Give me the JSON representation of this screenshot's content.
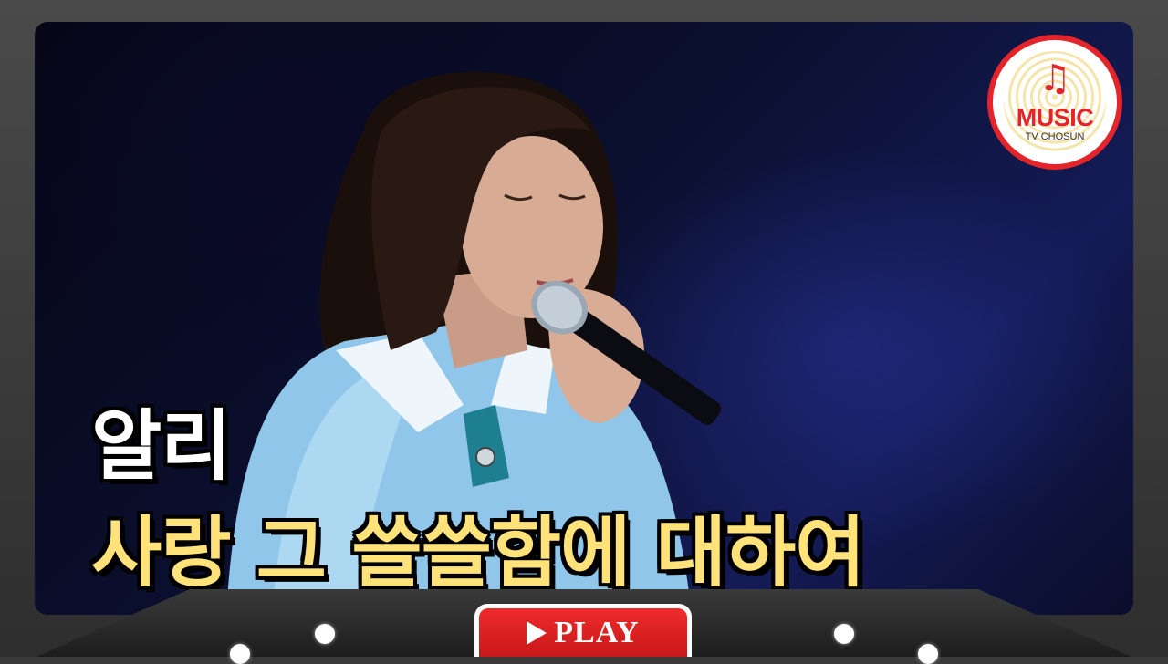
{
  "video": {
    "caption_artist": "알리",
    "caption_song": "사랑 그 쓸쓸함에 대하여"
  },
  "logo": {
    "title": "MUSIC",
    "subtitle": "TV CHOSUN",
    "note_icon": "music-note-icon",
    "brand_color": "#e3242b"
  },
  "player": {
    "play_label": "PLAY",
    "play_icon": "play-triangle-icon",
    "button_color": "#e3242b"
  },
  "colors": {
    "caption_primary": "#ffffff",
    "caption_accent": "#ffe37a"
  }
}
